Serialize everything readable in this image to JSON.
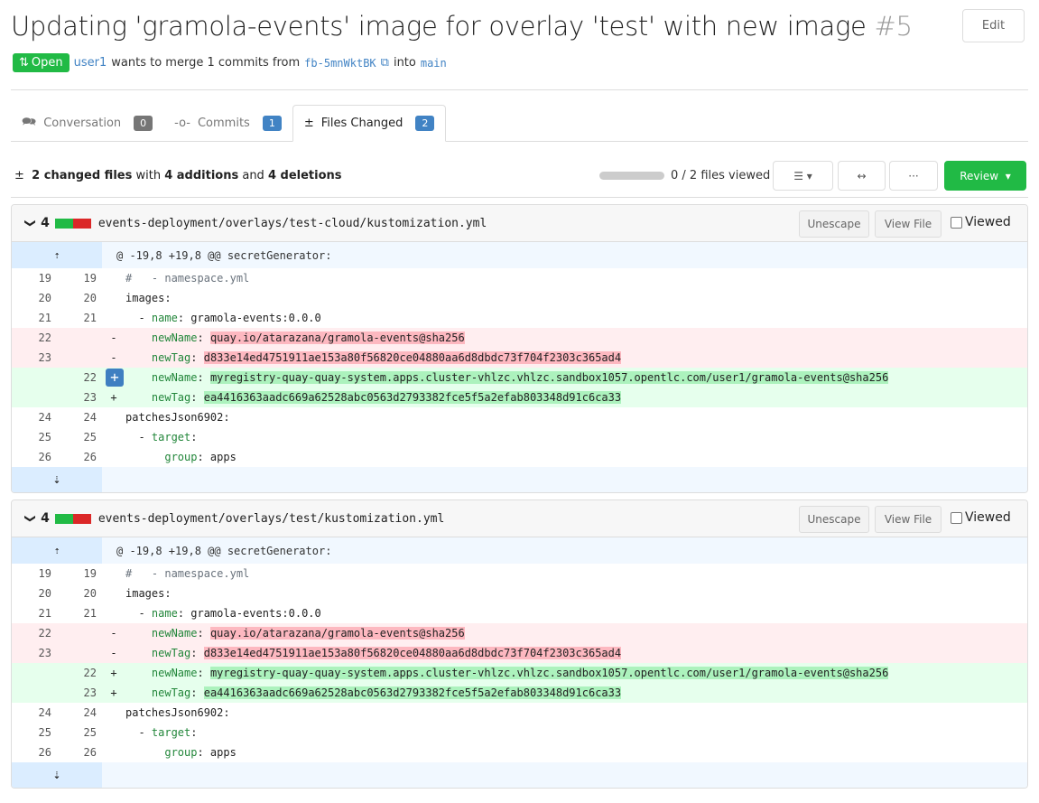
{
  "header": {
    "title": "Updating 'gramola-events' image for overlay 'test' with new image",
    "number": "#5",
    "edit_label": "Edit",
    "status": "Open",
    "author": "user1",
    "merge_text": "wants to merge 1 commits from",
    "head_branch": "fb-5mnWktBK",
    "into": "into",
    "base_branch": "main"
  },
  "tabs": [
    {
      "label": "Conversation",
      "count": "0",
      "icon": "comment-discussion-icon"
    },
    {
      "label": "Commits",
      "count": "1",
      "icon": "git-commit-icon"
    },
    {
      "label": "Files Changed",
      "count": "2",
      "icon": "diff-icon",
      "active": true
    }
  ],
  "toolbar": {
    "s1": "2 changed files",
    "s2": " with ",
    "s3": "4 additions",
    "s4": " and ",
    "s5": "4 deletions",
    "files_viewed": "0 / 2 files viewed",
    "viewed_fraction": 0,
    "review_label": "Review"
  },
  "colors": {
    "green": "#21ba45",
    "blue": "#4183c4",
    "del_bg": "#ffeef0",
    "add_bg": "#e6ffed"
  },
  "files": [
    {
      "changes": "4",
      "path": "events-deployment/overlays/test-cloud/kustomization.yml",
      "unescape": "Unescape",
      "view_file": "View File",
      "viewed": "Viewed",
      "hunk": "@ -19,8 +19,8 @@ secretGenerator:",
      "lines": [
        {
          "type": "ctx",
          "old": "19",
          "new": "19",
          "sign": "",
          "parts": [
            {
              "t": "#   - namespace.yml",
              "s": "c"
            }
          ]
        },
        {
          "type": "ctx",
          "old": "20",
          "new": "20",
          "sign": "",
          "parts": [
            {
              "t": "images:",
              "s": ""
            }
          ]
        },
        {
          "type": "ctx",
          "old": "21",
          "new": "21",
          "sign": "",
          "parts": [
            {
              "t": "  - ",
              "s": ""
            },
            {
              "t": "name",
              "s": "k"
            },
            {
              "t": ": gramola-events:0.0.0",
              "s": ""
            }
          ]
        },
        {
          "type": "del",
          "old": "22",
          "new": "",
          "sign": "-",
          "parts": [
            {
              "t": "    ",
              "s": ""
            },
            {
              "t": "newName",
              "s": "k"
            },
            {
              "t": ": ",
              "s": ""
            },
            {
              "t": "quay.io/atarazana/gramola-events@sha256",
              "s": "hl"
            }
          ]
        },
        {
          "type": "del",
          "old": "23",
          "new": "",
          "sign": "-",
          "parts": [
            {
              "t": "    ",
              "s": ""
            },
            {
              "t": "newTag",
              "s": "k"
            },
            {
              "t": ": ",
              "s": ""
            },
            {
              "t": "d833e14ed4751911ae153a80f56820ce04880aa6d8dbdc73f704f2303c365ad4",
              "s": "hl"
            }
          ]
        },
        {
          "type": "add",
          "old": "",
          "new": "22",
          "sign": "+",
          "plus_button": true,
          "parts": [
            {
              "t": "    ",
              "s": ""
            },
            {
              "t": "newName",
              "s": "k"
            },
            {
              "t": ": ",
              "s": ""
            },
            {
              "t": "myregistry-quay-quay-system.apps.cluster-vhlzc.vhlzc.sandbox1057.opentlc.com/user1/gramola-events@sha256",
              "s": "hl"
            }
          ]
        },
        {
          "type": "add",
          "old": "",
          "new": "23",
          "sign": "+",
          "parts": [
            {
              "t": "    ",
              "s": ""
            },
            {
              "t": "newTag",
              "s": "k"
            },
            {
              "t": ": ",
              "s": ""
            },
            {
              "t": "ea4416363aadc669a62528abc0563d2793382fce5f5a2efab803348d91c6ca33",
              "s": "hl"
            }
          ]
        },
        {
          "type": "ctx",
          "old": "24",
          "new": "24",
          "sign": "",
          "parts": [
            {
              "t": "patchesJson6902:",
              "s": ""
            }
          ]
        },
        {
          "type": "ctx",
          "old": "25",
          "new": "25",
          "sign": "",
          "parts": [
            {
              "t": "  - ",
              "s": ""
            },
            {
              "t": "target",
              "s": "k"
            },
            {
              "t": ":",
              "s": ""
            }
          ]
        },
        {
          "type": "ctx",
          "old": "26",
          "new": "26",
          "sign": "",
          "parts": [
            {
              "t": "      ",
              "s": ""
            },
            {
              "t": "group",
              "s": "k"
            },
            {
              "t": ": apps",
              "s": ""
            }
          ]
        }
      ]
    },
    {
      "changes": "4",
      "path": "events-deployment/overlays/test/kustomization.yml",
      "unescape": "Unescape",
      "view_file": "View File",
      "viewed": "Viewed",
      "hunk": "@ -19,8 +19,8 @@ secretGenerator:",
      "lines": [
        {
          "type": "ctx",
          "old": "19",
          "new": "19",
          "sign": "",
          "parts": [
            {
              "t": "#   - namespace.yml",
              "s": "c"
            }
          ]
        },
        {
          "type": "ctx",
          "old": "20",
          "new": "20",
          "sign": "",
          "parts": [
            {
              "t": "images:",
              "s": ""
            }
          ]
        },
        {
          "type": "ctx",
          "old": "21",
          "new": "21",
          "sign": "",
          "parts": [
            {
              "t": "  - ",
              "s": ""
            },
            {
              "t": "name",
              "s": "k"
            },
            {
              "t": ": gramola-events:0.0.0",
              "s": ""
            }
          ]
        },
        {
          "type": "del",
          "old": "22",
          "new": "",
          "sign": "-",
          "parts": [
            {
              "t": "    ",
              "s": ""
            },
            {
              "t": "newName",
              "s": "k"
            },
            {
              "t": ": ",
              "s": ""
            },
            {
              "t": "quay.io/atarazana/gramola-events@sha256",
              "s": "hl"
            }
          ]
        },
        {
          "type": "del",
          "old": "23",
          "new": "",
          "sign": "-",
          "parts": [
            {
              "t": "    ",
              "s": ""
            },
            {
              "t": "newTag",
              "s": "k"
            },
            {
              "t": ": ",
              "s": ""
            },
            {
              "t": "d833e14ed4751911ae153a80f56820ce04880aa6d8dbdc73f704f2303c365ad4",
              "s": "hl"
            }
          ]
        },
        {
          "type": "add",
          "old": "",
          "new": "22",
          "sign": "+",
          "parts": [
            {
              "t": "    ",
              "s": ""
            },
            {
              "t": "newName",
              "s": "k"
            },
            {
              "t": ": ",
              "s": ""
            },
            {
              "t": "myregistry-quay-quay-system.apps.cluster-vhlzc.vhlzc.sandbox1057.opentlc.com/user1/gramola-events@sha256",
              "s": "hl"
            }
          ]
        },
        {
          "type": "add",
          "old": "",
          "new": "23",
          "sign": "+",
          "parts": [
            {
              "t": "    ",
              "s": ""
            },
            {
              "t": "newTag",
              "s": "k"
            },
            {
              "t": ": ",
              "s": ""
            },
            {
              "t": "ea4416363aadc669a62528abc0563d2793382fce5f5a2efab803348d91c6ca33",
              "s": "hl"
            }
          ]
        },
        {
          "type": "ctx",
          "old": "24",
          "new": "24",
          "sign": "",
          "parts": [
            {
              "t": "patchesJson6902:",
              "s": ""
            }
          ]
        },
        {
          "type": "ctx",
          "old": "25",
          "new": "25",
          "sign": "",
          "parts": [
            {
              "t": "  - ",
              "s": ""
            },
            {
              "t": "target",
              "s": "k"
            },
            {
              "t": ":",
              "s": ""
            }
          ]
        },
        {
          "type": "ctx",
          "old": "26",
          "new": "26",
          "sign": "",
          "parts": [
            {
              "t": "      ",
              "s": ""
            },
            {
              "t": "group",
              "s": "k"
            },
            {
              "t": ": apps",
              "s": ""
            }
          ]
        }
      ]
    }
  ]
}
